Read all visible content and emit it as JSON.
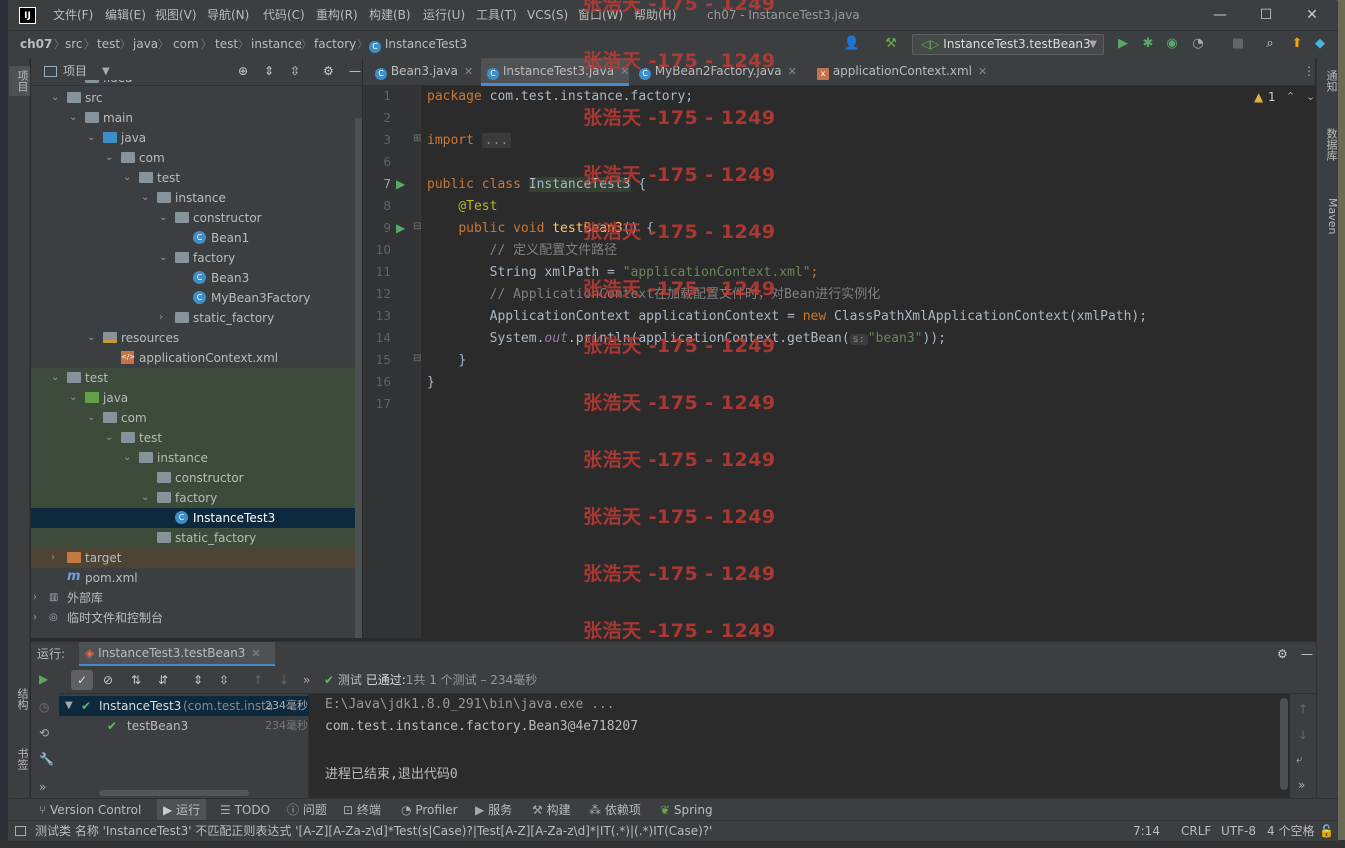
{
  "title_bar": {
    "menus": [
      "文件(F)",
      "编辑(E)",
      "视图(V)",
      "导航(N)",
      "代码(C)",
      "重构(R)",
      "构建(B)",
      "运行(U)",
      "工具(T)",
      "VCS(S)",
      "窗口(W)",
      "帮助(H)"
    ],
    "window_title": "ch07 - InstanceTest3.java"
  },
  "breadcrumbs": [
    "ch07",
    "src",
    "test",
    "java",
    "com",
    "test",
    "instance",
    "factory",
    "InstanceTest3"
  ],
  "run_config": "InstanceTest3.testBean3",
  "left_strip": {
    "project": "项目",
    "structure": "结构",
    "bookmarks": "书签"
  },
  "right_strip": {
    "notifications": "通知",
    "database": "数据库",
    "maven": "Maven"
  },
  "project_panel": {
    "title": "项目",
    "tree": [
      {
        "label": ".idea",
        "icon": "folder"
      },
      {
        "label": "src",
        "icon": "folder"
      },
      {
        "label": "main",
        "icon": "folder"
      },
      {
        "label": "java",
        "icon": "folder-blue"
      },
      {
        "label": "com",
        "icon": "folder"
      },
      {
        "label": "test",
        "icon": "folder"
      },
      {
        "label": "instance",
        "icon": "folder"
      },
      {
        "label": "constructor",
        "icon": "folder"
      },
      {
        "label": "Bean1",
        "icon": "class"
      },
      {
        "label": "factory",
        "icon": "folder"
      },
      {
        "label": "Bean3",
        "icon": "class"
      },
      {
        "label": "MyBean3Factory",
        "icon": "class"
      },
      {
        "label": "static_factory",
        "icon": "folder"
      },
      {
        "label": "resources",
        "icon": "folder-res"
      },
      {
        "label": "applicationContext.xml",
        "icon": "xml"
      },
      {
        "label": "test",
        "icon": "folder"
      },
      {
        "label": "java",
        "icon": "folder-green"
      },
      {
        "label": "com",
        "icon": "folder"
      },
      {
        "label": "test",
        "icon": "folder"
      },
      {
        "label": "instance",
        "icon": "folder"
      },
      {
        "label": "constructor",
        "icon": "folder"
      },
      {
        "label": "factory",
        "icon": "folder"
      },
      {
        "label": "InstanceTest3",
        "icon": "class"
      },
      {
        "label": "static_factory",
        "icon": "folder"
      },
      {
        "label": "target",
        "icon": "folder-orange"
      },
      {
        "label": "pom.xml",
        "icon": "maven"
      },
      {
        "label": "外部库",
        "icon": "library"
      },
      {
        "label": "临时文件和控制台",
        "icon": "scratch"
      }
    ]
  },
  "editor_tabs": [
    {
      "label": "Bean3.java"
    },
    {
      "label": "InstanceTest3.java"
    },
    {
      "label": "MyBean2Factory.java"
    },
    {
      "label": "applicationContext.xml"
    }
  ],
  "editor": {
    "warnings": "1",
    "line_numbers": [
      "1",
      "2",
      "3",
      "6",
      "7",
      "8",
      "9",
      "10",
      "11",
      "12",
      "13",
      "14",
      "15",
      "16",
      "17"
    ],
    "code": {
      "l1_kw": "package",
      "l1_rest": " com.test.instance.factory;",
      "l3_kw": "import",
      "l3_fold": "...",
      "l7_kw": "public class",
      "l7_cls": "InstanceTest3",
      "l7_rest": " {",
      "l8_ann": "@Test",
      "l9_kw": "public void",
      "l9_fn": "testBean3",
      "l9_rest": "() {",
      "l10_cmt": "// 定义配置文件路径",
      "l11_a": "String xmlPath = ",
      "l11_str": "\"applicationContext.xml\"",
      "l11_b": ";",
      "l12_cmt": "// ApplicationContext在加载配置文件时，对Bean进行实例化",
      "l13_a": "ApplicationContext applicationContext = ",
      "l13_kw": "new",
      "l13_b": " ClassPathXmlApplicationContext(xmlPath);",
      "l14_a": "System.",
      "l14_fld": "out",
      "l14_b": ".println(applicationContext.getBean(",
      "l14_hint": "s:",
      "l14_str": "\"bean3\"",
      "l14_c": "));",
      "l15": "}",
      "l16": "}"
    }
  },
  "run_panel": {
    "label": "运行:",
    "tab": "InstanceTest3.testBean3",
    "status_prefix": "测试",
    "status_passed": "已通过:",
    "status_count": "1共 1 个测试 – 234毫秒",
    "tree": [
      {
        "label": "InstanceTest3",
        "detail": "(com.test.insta",
        "time": "234毫秒"
      },
      {
        "label": "testBean3",
        "time": "234毫秒"
      }
    ],
    "console": [
      "E:\\Java\\jdk1.8.0_291\\bin\\java.exe ...",
      "com.test.instance.factory.Bean3@4e718207",
      "",
      "进程已结束,退出代码0"
    ]
  },
  "tool_tabs": [
    "Version Control",
    "运行",
    "TODO",
    "问题",
    "终端",
    "Profiler",
    "服务",
    "构建",
    "依赖项",
    "Spring"
  ],
  "status_bar": {
    "message": "测试类 名称 'InstanceTest3' 不匹配正则表达式 '[A-Z][A-Za-z\\d]*Test(s|Case)?|Test[A-Z][A-Za-z\\d]*|IT(.*)|(.*)IT(Case)?'",
    "position": "7:14",
    "line_sep": "CRLF",
    "encoding": "UTF-8",
    "indent": "4 个空格"
  },
  "watermark": "张浩天 -175 - 1249",
  "colors": {
    "accent": "#4a88c7",
    "pass": "#5fb95f",
    "keyword": "#cc7832",
    "string": "#6a8759"
  }
}
